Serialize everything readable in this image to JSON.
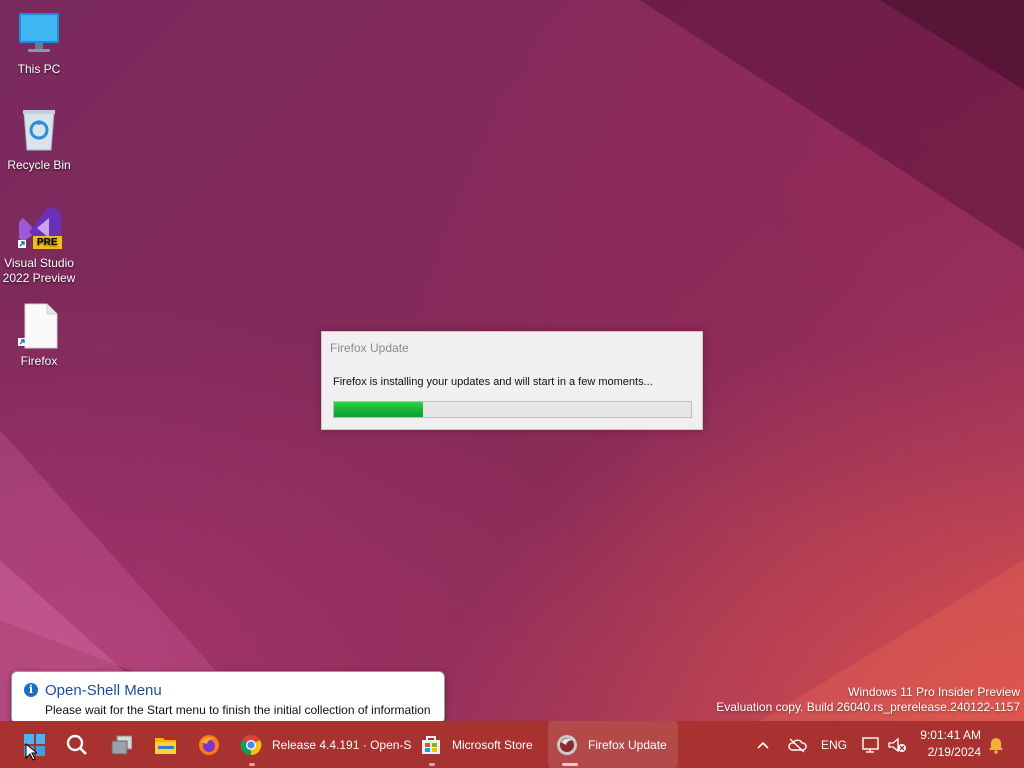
{
  "desktop": {
    "icons": [
      {
        "label": "This PC"
      },
      {
        "label": "Recycle Bin"
      },
      {
        "label": "Visual Studio 2022 Preview",
        "badge": "PRE"
      },
      {
        "label": "Firefox"
      }
    ]
  },
  "dialog": {
    "title": "Firefox Update",
    "message": "Firefox is installing your updates and will start in a few moments...",
    "progress_percent": 25
  },
  "watermark": {
    "line1": "Windows 11 Pro Insider Preview",
    "line2": "Evaluation copy. Build 26040.rs_prerelease.240122-1157"
  },
  "tooltip": {
    "title": "Open-Shell Menu",
    "body": "Please wait for the Start menu to finish the initial collection of information"
  },
  "taskbar": {
    "apps": [
      {
        "icon": "chrome-icon",
        "label": "Release 4.4.191 · Open-S"
      },
      {
        "icon": "store-icon",
        "label": "Microsoft Store"
      },
      {
        "icon": "firefox-update-icon",
        "label": "Firefox Update"
      }
    ],
    "language": "ENG",
    "time": "9:01:41 AM",
    "date": "2/19/2024"
  },
  "colors": {
    "taskbar": "#a7322f",
    "progress": "#13b034",
    "tooltip_title": "#1a4f9c"
  }
}
